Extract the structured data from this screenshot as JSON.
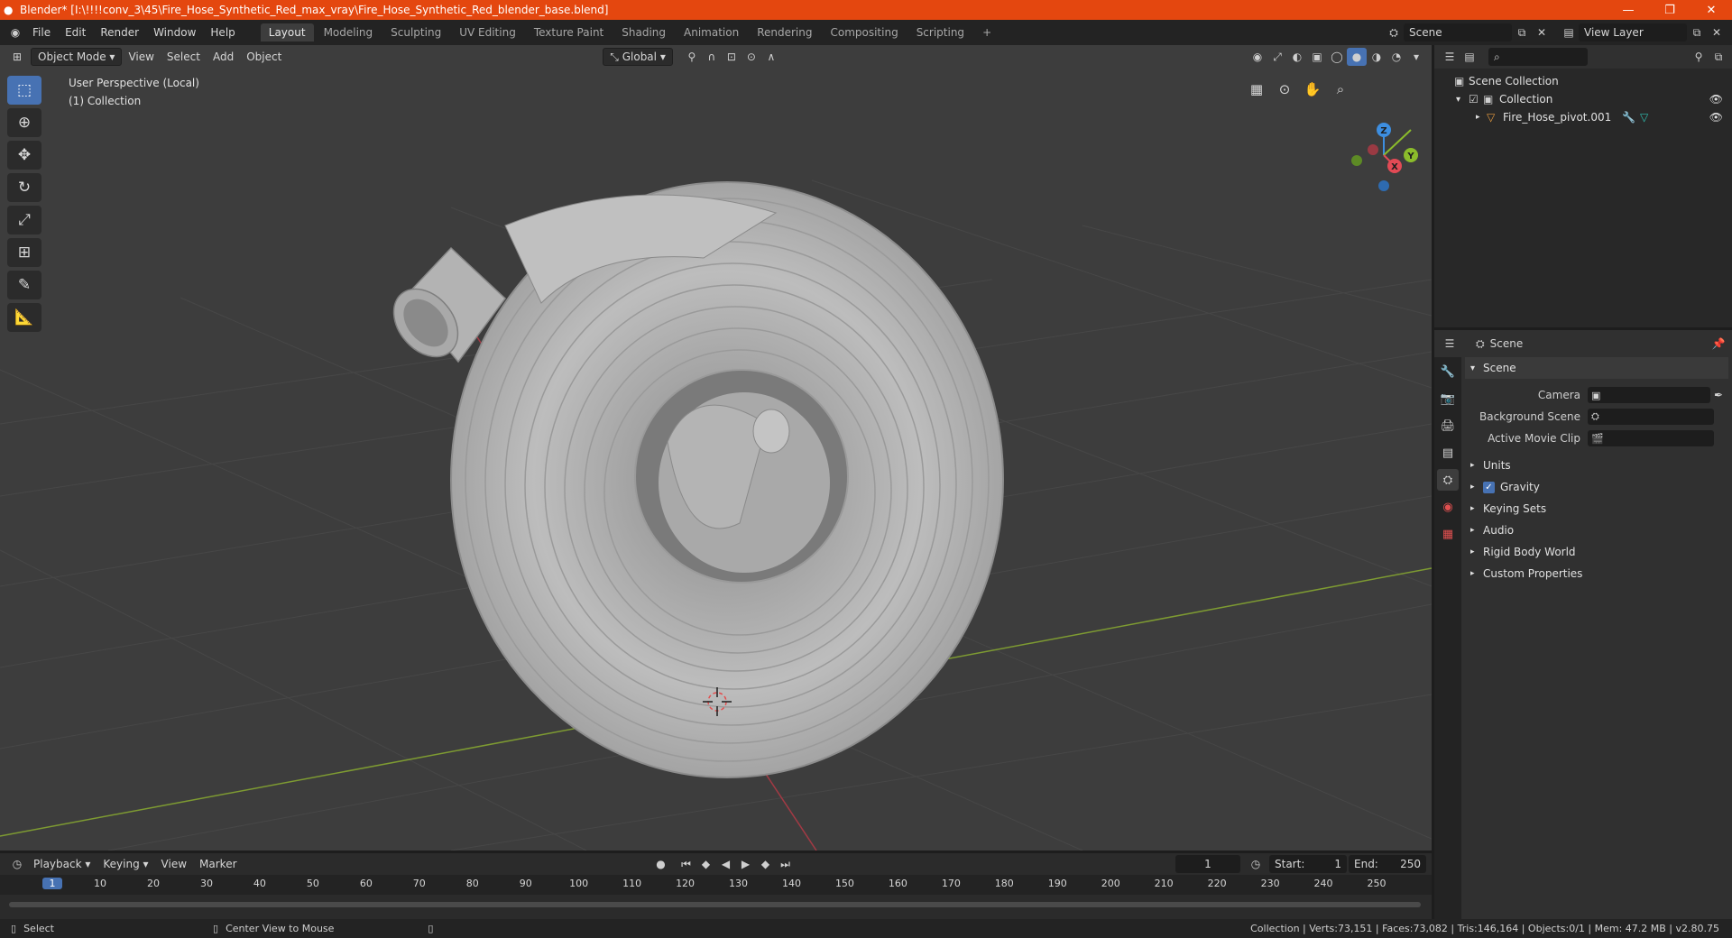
{
  "window": {
    "title": "Blender* [I:\\!!!!conv_3\\45\\Fire_Hose_Synthetic_Red_max_vray\\Fire_Hose_Synthetic_Red_blender_base.blend]",
    "minimize": "—",
    "maximize": "❐",
    "close": "✕"
  },
  "menu": [
    "File",
    "Edit",
    "Render",
    "Window",
    "Help"
  ],
  "workspaces": [
    "Layout",
    "Modeling",
    "Sculpting",
    "UV Editing",
    "Texture Paint",
    "Shading",
    "Animation",
    "Rendering",
    "Compositing",
    "Scripting"
  ],
  "workspace_add": "+",
  "scene_selector": "Scene",
  "view_layer": "View Layer",
  "viewport": {
    "mode": "Object Mode",
    "menus": [
      "View",
      "Select",
      "Add",
      "Object"
    ],
    "orientation": "Global",
    "perspective_label": "User Perspective (Local)",
    "collection_label": "(1) Collection",
    "gizmo_axes": {
      "x": "X",
      "y": "Y",
      "z": "Z"
    }
  },
  "outliner": {
    "search_placeholder": "",
    "scene_collection": "Scene Collection",
    "collection": "Collection",
    "object": "Fire_Hose_pivot.001"
  },
  "properties": {
    "header": "Scene",
    "panel": "Scene",
    "camera_label": "Camera",
    "background_scene_label": "Background Scene",
    "active_movie_clip_label": "Active Movie Clip",
    "sections": [
      "Units",
      "Gravity",
      "Keying Sets",
      "Audio",
      "Rigid Body World",
      "Custom Properties"
    ],
    "gravity_checked": true
  },
  "timeline": {
    "menus": [
      "Playback",
      "Keying",
      "View",
      "Marker"
    ],
    "current_frame": "1",
    "start_label": "Start:",
    "start": "1",
    "end_label": "End:",
    "end": "250",
    "ruler": [
      "1",
      "10",
      "20",
      "30",
      "40",
      "50",
      "60",
      "70",
      "80",
      "90",
      "100",
      "110",
      "120",
      "130",
      "140",
      "150",
      "160",
      "170",
      "180",
      "190",
      "200",
      "210",
      "220",
      "230",
      "240",
      "250"
    ]
  },
  "status": {
    "left_action": "Select",
    "middle_action": "Center View to Mouse",
    "stats": "Collection | Verts:73,151 | Faces:73,082 | Tris:146,164 | Objects:0/1 | Mem: 47.2 MB | v2.80.75"
  },
  "colors": {
    "titlebar": "#e4470f",
    "accent": "#4772b3",
    "x_axis": "#e24a55",
    "y_axis": "#8bbc2b",
    "z_axis": "#3d8ee0"
  }
}
